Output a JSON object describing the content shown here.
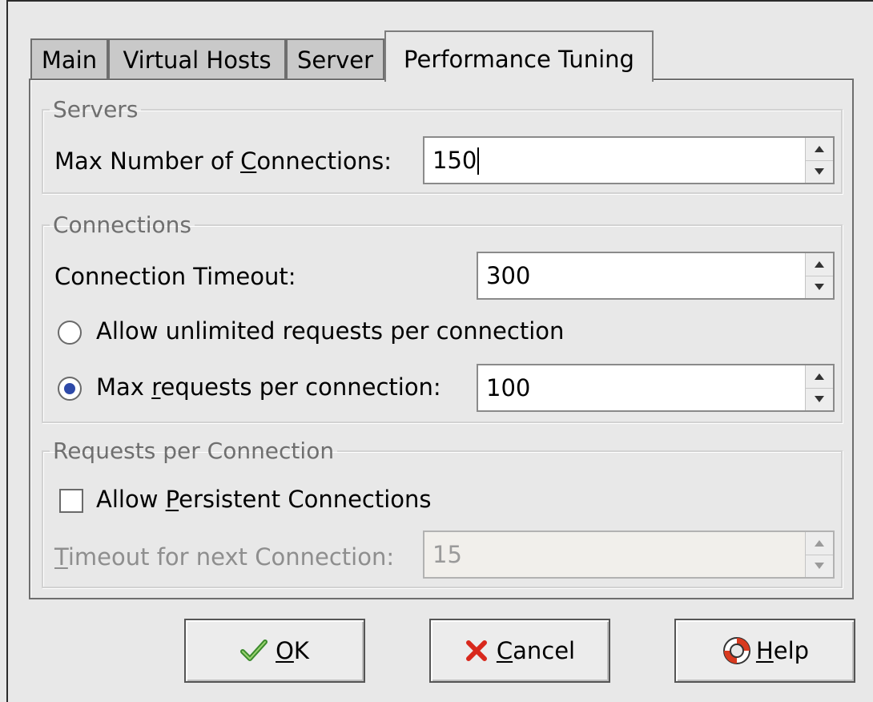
{
  "tabs": [
    {
      "label": "Main"
    },
    {
      "label": "Virtual Hosts"
    },
    {
      "label": "Server"
    },
    {
      "label": "Performance Tuning"
    }
  ],
  "servers": {
    "legend": "Servers",
    "max_connections_label_a": "Max Number of ",
    "max_connections_label_u": "C",
    "max_connections_label_b": "onnections:",
    "max_connections_value": "150"
  },
  "connections": {
    "legend": "Connections",
    "timeout_label": "Connection Timeout:",
    "timeout_value": "300",
    "unlimited_label": "Allow unlimited requests per connection",
    "unlimited_selected": false,
    "max_requests_label_a": "Max ",
    "max_requests_label_u": "r",
    "max_requests_label_b": "equests per connection:",
    "max_requests_selected": true,
    "max_requests_value": "100"
  },
  "requests": {
    "legend": "Requests per Connection",
    "persistent_label_a": "Allow ",
    "persistent_label_u": "P",
    "persistent_label_b": "ersistent Connections",
    "persistent_checked": false,
    "next_timeout_label_u": "T",
    "next_timeout_label_b": "imeout for next Connection:",
    "next_timeout_value": "15"
  },
  "buttons": {
    "ok_u": "O",
    "ok_b": "K",
    "cancel_u": "C",
    "cancel_b": "ancel",
    "help_u": "H",
    "help_b": "elp"
  },
  "icons": {
    "ok": "check-icon",
    "cancel": "x-icon",
    "help": "lifebuoy-icon"
  },
  "colors": {
    "radio_selected": "#2e4aa8",
    "ok_icon": "#3c8a2e",
    "cancel_icon": "#d8281c",
    "help_icon": "#d83a1f"
  }
}
